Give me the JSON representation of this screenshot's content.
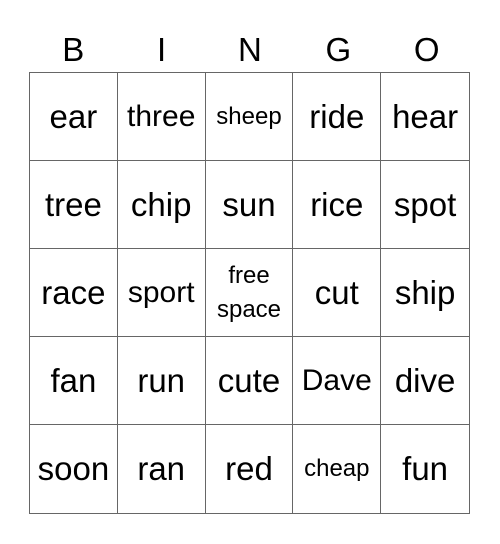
{
  "header": [
    "B",
    "I",
    "N",
    "G",
    "O"
  ],
  "cells": [
    {
      "text": "ear",
      "size": "lg"
    },
    {
      "text": "three",
      "size": "md"
    },
    {
      "text": "sheep",
      "size": "sm"
    },
    {
      "text": "ride",
      "size": "lg"
    },
    {
      "text": "hear",
      "size": "lg"
    },
    {
      "text": "tree",
      "size": "lg"
    },
    {
      "text": "chip",
      "size": "lg"
    },
    {
      "text": "sun",
      "size": "lg"
    },
    {
      "text": "rice",
      "size": "lg"
    },
    {
      "text": "spot",
      "size": "lg"
    },
    {
      "text": "race",
      "size": "lg"
    },
    {
      "text": "sport",
      "size": "md"
    },
    {
      "text": "free space",
      "size": "free"
    },
    {
      "text": "cut",
      "size": "lg"
    },
    {
      "text": "ship",
      "size": "lg"
    },
    {
      "text": "fan",
      "size": "lg"
    },
    {
      "text": "run",
      "size": "lg"
    },
    {
      "text": "cute",
      "size": "lg"
    },
    {
      "text": "Dave",
      "size": "md"
    },
    {
      "text": "dive",
      "size": "lg"
    },
    {
      "text": "soon",
      "size": "lg"
    },
    {
      "text": "ran",
      "size": "lg"
    },
    {
      "text": "red",
      "size": "lg"
    },
    {
      "text": "cheap",
      "size": "sm"
    },
    {
      "text": "fun",
      "size": "lg"
    }
  ]
}
